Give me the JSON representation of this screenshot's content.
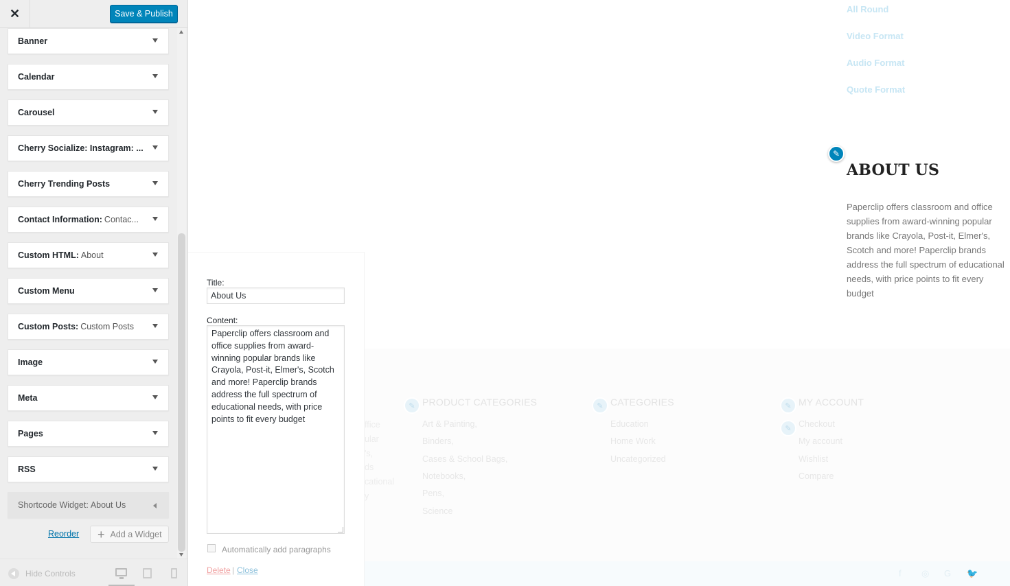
{
  "topbar": {
    "close_glyph": "✕",
    "save_label": "Save & Publish"
  },
  "widgets": [
    {
      "name": "Banner",
      "sub": ""
    },
    {
      "name": "Calendar",
      "sub": ""
    },
    {
      "name": "Carousel",
      "sub": ""
    },
    {
      "name": "Cherry Socialize: Instagram: ...",
      "sub": ""
    },
    {
      "name": "Cherry Trending Posts",
      "sub": ""
    },
    {
      "name": "Contact Information:",
      "sub": "Contac..."
    },
    {
      "name": "Custom HTML:",
      "sub": "About"
    },
    {
      "name": "Custom Menu",
      "sub": ""
    },
    {
      "name": "Custom Posts:",
      "sub": "Custom Posts"
    },
    {
      "name": "Image",
      "sub": ""
    },
    {
      "name": "Meta",
      "sub": ""
    },
    {
      "name": "Pages",
      "sub": ""
    },
    {
      "name": "RSS",
      "sub": ""
    },
    {
      "name": "Shortcode Widget:",
      "sub": "About Us"
    }
  ],
  "sidebar_actions": {
    "reorder": "Reorder",
    "add_widget": "Add a Widget",
    "plus_glyph": "+"
  },
  "footer": {
    "hide_controls": "Hide Controls"
  },
  "edit_form": {
    "title_label": "Title:",
    "title_value": "About Us",
    "content_label": "Content:",
    "content_value": "Paperclip offers classroom and office supplies from award-winning popular brands like Crayola, Post-it, Elmer's, Scotch and more! Paperclip brands address the full spectrum of educational needs, with price points to fit every budget",
    "autop_label": "Automatically add paragraphs",
    "delete": "Delete",
    "separator": "|",
    "close": "Close"
  },
  "preview": {
    "nav_links": [
      "All Round",
      "Video Format",
      "Audio Format",
      "Quote Format"
    ],
    "about_heading": "ABOUT US",
    "about_text": "Paperclip offers classroom and office supplies from award-winning popular brands like Crayola, Post-it, Elmer's, Scotch and more! Paperclip brands address the full spectrum of educational needs, with price points to fit every budget",
    "pencil_glyph": "✎",
    "partial_lines": [
      "ffice",
      "ular",
      "'s,",
      "ds",
      "cational",
      "y"
    ],
    "product_categories": {
      "heading": "PRODUCT CATEGORIES",
      "items": [
        "Art & Painting,",
        "Binders,",
        "Cases & School Bags,",
        "Notebooks,",
        "Pens,",
        "Science"
      ]
    },
    "categories": {
      "heading": "CATEGORIES",
      "items": [
        "Education",
        "Home Work",
        "Uncategorized"
      ]
    },
    "my_account": {
      "heading": "MY ACCOUNT",
      "items": [
        "Checkout",
        "My account",
        "Wishlist",
        "Compare"
      ]
    },
    "social_icons": [
      "f",
      "◎",
      "G",
      "🐦"
    ]
  }
}
